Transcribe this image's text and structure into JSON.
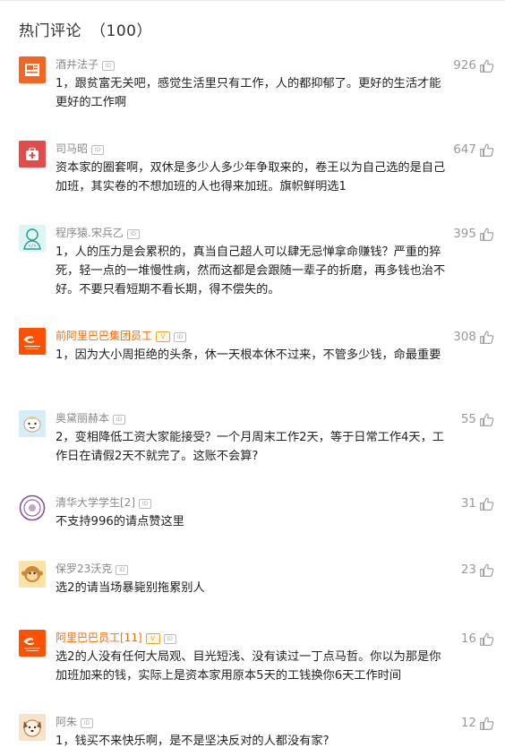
{
  "header": {
    "title": "热门评论",
    "count": "（100）"
  },
  "comments": [
    {
      "name": "酒井法子",
      "text": "1，跟贫富无关吧，感觉生活里只有工作，人的都抑郁了。更好的生活才能更好的工作啊",
      "likes": "926",
      "avatar": "news-avatar"
    },
    {
      "name": "司马昭",
      "text": "资本家的圈套啊，双休是多少人多少年争取来的，卷王以为自己选的是自己加班，其实卷的不想加班的人也得来加班。旗帜鲜明选1",
      "likes": "647",
      "avatar": "medical-kit-avatar"
    },
    {
      "name": "程序猿.宋兵乙",
      "text": "1，人的压力是会累积的，真当自己超人可以肆无忌惮拿命赚钱？严重的猝死，轻一点的一堆慢性病，然而这都是会跟随一辈子的折磨，再多钱也治不好。不要只看短期不看长期，得不偿失的。",
      "likes": "395",
      "avatar": "programmer-avatar"
    },
    {
      "name": "前阿里巴巴集团员工",
      "text": "1，因为大小周拒绝的头条，休一天根本休不过来，不管多少钱，命最重要",
      "likes": "308",
      "avatar": "alibaba-avatar"
    },
    {
      "name": "奥黛丽赫本",
      "text": "2，变相降低工资大家能接受？一个月周末工作2天，等于日常工作4天，工作日在请假2天不就完了。这账不会算?",
      "likes": "55",
      "avatar": "cartoon-avatar"
    },
    {
      "name": "清华大学学生[2]",
      "text": "不支持996的请点赞这里",
      "likes": "31",
      "avatar": "tsinghua-avatar"
    },
    {
      "name": "保罗23沃克",
      "text": "选2的请当场暴毙别拖累别人",
      "likes": "23",
      "avatar": "monkey-avatar"
    },
    {
      "name": "阿里巴巴员工[11]",
      "text": "选2的人没有任何大局观、目光短浅、没有读过一丁点马哲。你以为那是你加班加来的钱，实际上是资本家用原本5天的工钱换你6天工作时间",
      "likes": "16",
      "avatar": "alibaba-avatar"
    },
    {
      "name": "阿朱",
      "text": "1，钱买不来快乐啊，是不是坚决反对的人都没有家?",
      "likes": "12",
      "avatar": "dog-avatar"
    }
  ],
  "badge_text": "ID",
  "vbadge_text": "V",
  "colors": {
    "accent": "#ff6a00",
    "muted": "#999999"
  }
}
